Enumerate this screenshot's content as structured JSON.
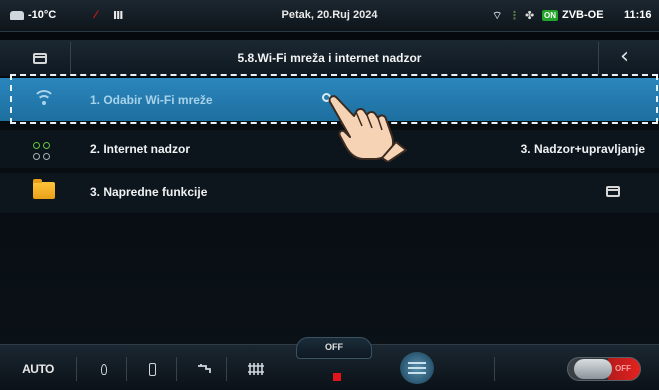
{
  "status_bar": {
    "outside_temp": "-10°C",
    "date": "Petak, 20.Ruj 2024",
    "on_badge": "ON",
    "device_name": "ZVB-OE",
    "time": "11:16"
  },
  "title_bar": {
    "title": "5.8.Wi-Fi mreža i internet nadzor"
  },
  "menu_items": [
    {
      "label": "1. Odabir Wi-Fi mreže",
      "value": "",
      "icon": "wifi-icon",
      "selected": true
    },
    {
      "label": "2. Internet nadzor",
      "value": "3. Nadzor+upravljanje",
      "icon": "network-icon"
    },
    {
      "label": "3. Napredne funkcije",
      "value": "",
      "icon": "folder-icon"
    }
  ],
  "bottom_bar": {
    "mode_label": "AUTO",
    "off_label": "OFF",
    "toggle_label": "OFF"
  },
  "colors": {
    "selected_row": "#2b86bd",
    "status_on": "#22a32a",
    "stop_red": "#e0141a",
    "toggle_red": "#e3231f"
  }
}
